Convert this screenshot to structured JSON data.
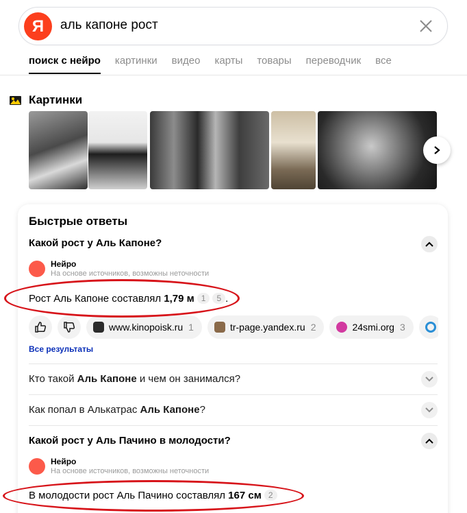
{
  "search": {
    "logo_letter": "Я",
    "query": "аль капоне рост"
  },
  "tabs": [
    {
      "label": "поиск с нейро",
      "active": true
    },
    {
      "label": "картинки"
    },
    {
      "label": "видео"
    },
    {
      "label": "карты"
    },
    {
      "label": "товары"
    },
    {
      "label": "переводчик"
    },
    {
      "label": "все"
    }
  ],
  "images": {
    "title": "Картинки"
  },
  "quick_answers": {
    "title": "Быстрые ответы",
    "first_question": "Какой рост у Аль Капоне?",
    "neuro": {
      "name": "Нейро",
      "subtitle": "На основе источников, возможны неточности"
    },
    "first_answer": {
      "prefix": "Рост Аль Капоне составлял ",
      "value": "1,79 м",
      "ref1": "1",
      "ref2": "5",
      "suffix": "."
    },
    "sources": [
      {
        "domain": "www.kinopoisk.ru",
        "count": "1",
        "color": "#2b2b2b"
      },
      {
        "domain": "tr-page.yandex.ru",
        "count": "2",
        "color": "#8a6a4a"
      },
      {
        "domain": "24smi.org",
        "count": "3",
        "color": "#d23aa0"
      }
    ],
    "all_results": "Все результаты",
    "related": [
      {
        "before": "Кто такой ",
        "bold": "Аль Капоне",
        "after": " и чем он занимался?"
      },
      {
        "before": "Как попал в Алькатрас ",
        "bold": "Аль Капоне",
        "after": "?"
      }
    ],
    "second_question": "Какой рост у Аль Пачино в молодости?",
    "second_neuro": {
      "name": "Нейро",
      "subtitle": "На основе источников, возможны неточности"
    },
    "second_answer": {
      "prefix": "В молодости рост Аль Пачино составлял ",
      "value": "167 см",
      "ref": "2"
    }
  },
  "colors": {
    "brand": "#fc3f1d",
    "annotation": "#d7141a",
    "link": "#0a2fb8"
  }
}
